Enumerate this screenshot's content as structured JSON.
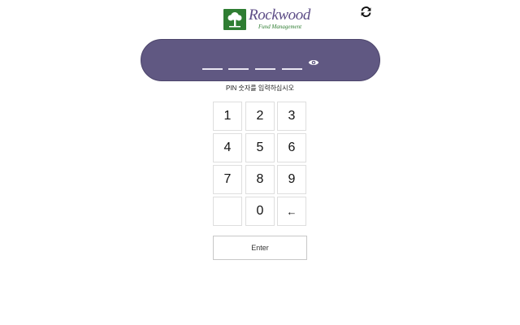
{
  "brand": {
    "name": "Rockwood",
    "tagline": "Fund Management",
    "logo_color": "#2e7d32",
    "name_color": "#5c4c86"
  },
  "header": {
    "refresh_icon": "refresh-icon"
  },
  "pin_entry": {
    "panel_color": "#605882",
    "slots": [
      "",
      "",
      "",
      ""
    ],
    "visibility_icon": "eye-icon",
    "prompt": "PIN 숫자를 입력하십시오"
  },
  "keypad": {
    "keys": [
      "1",
      "2",
      "3",
      "4",
      "5",
      "6",
      "7",
      "8",
      "9",
      "",
      "0",
      "←"
    ]
  },
  "actions": {
    "enter_label": "Enter"
  }
}
